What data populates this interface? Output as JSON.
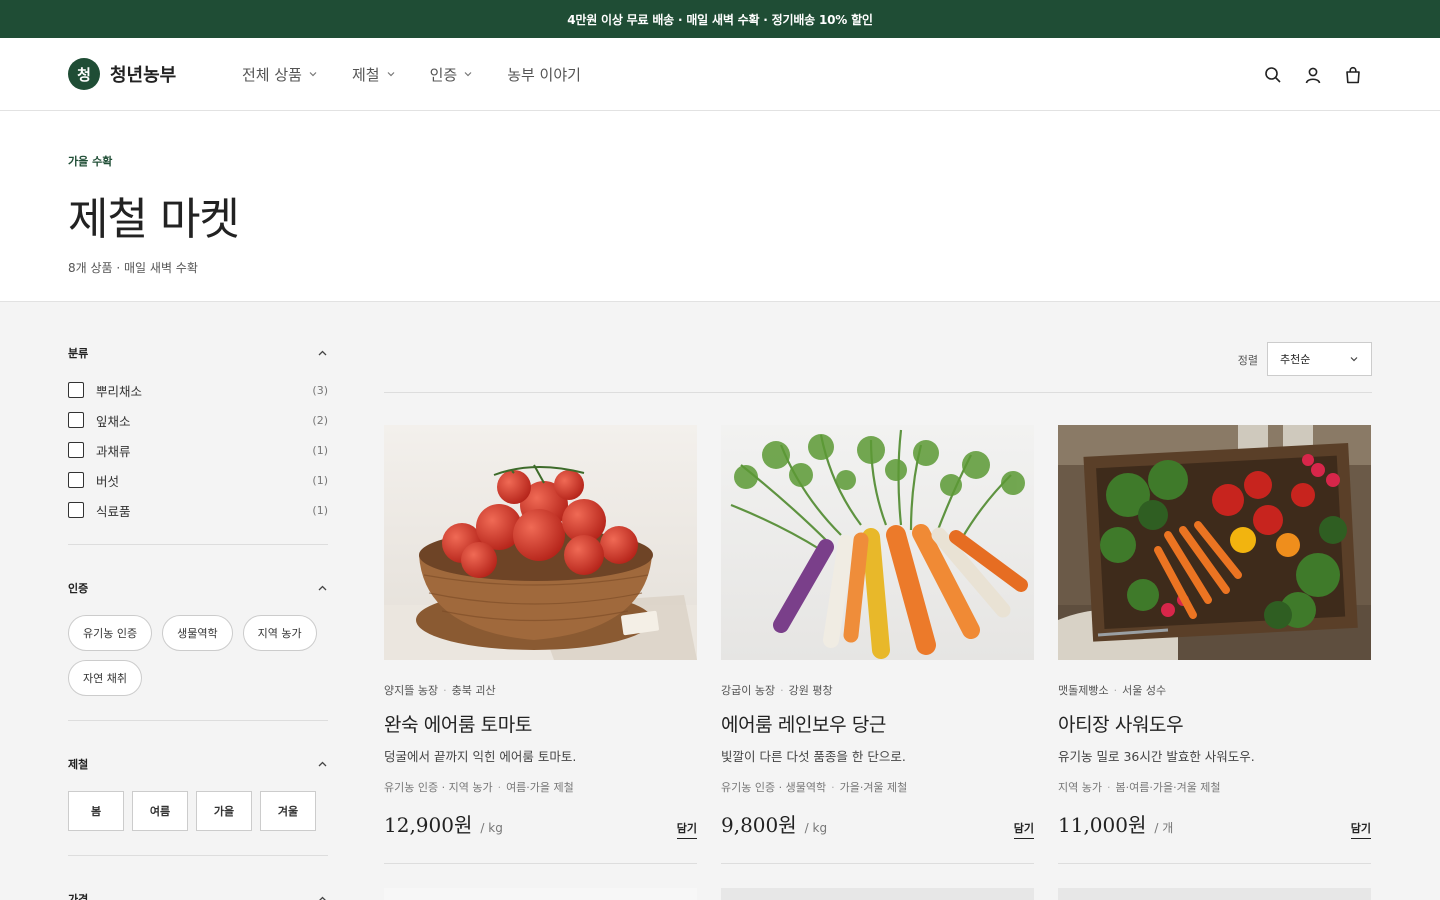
{
  "promo": "4만원 이상 무료 배송 · 매일 새벽 수확 · 정기배송 10% 할인",
  "brand": {
    "mark": "청",
    "name": "청년농부",
    "color": "#1f4d35"
  },
  "nav": [
    {
      "label": "전체 상품",
      "dropdown": true
    },
    {
      "label": "제철",
      "dropdown": true
    },
    {
      "label": "인증",
      "dropdown": true
    },
    {
      "label": "농부 이야기",
      "dropdown": false
    }
  ],
  "header_icons": [
    "search-icon",
    "user-icon",
    "bag-icon"
  ],
  "hero": {
    "eyebrow": "가을 수확",
    "title": "제철 마켓",
    "subtitle": "8개 상품 · 매일 새벽 수확"
  },
  "filters": {
    "category": {
      "title": "분류",
      "items": [
        {
          "label": "뿌리채소",
          "count": "(3)"
        },
        {
          "label": "잎채소",
          "count": "(2)"
        },
        {
          "label": "과채류",
          "count": "(1)"
        },
        {
          "label": "버섯",
          "count": "(1)"
        },
        {
          "label": "식료품",
          "count": "(1)"
        }
      ]
    },
    "certification": {
      "title": "인증",
      "chips": [
        "유기농 인증",
        "생물역학",
        "지역 농가",
        "자연 채취"
      ]
    },
    "season": {
      "title": "제철",
      "options": [
        "봄",
        "여름",
        "가을",
        "겨울"
      ]
    },
    "price": {
      "title": "가격"
    }
  },
  "sort": {
    "label": "정렬",
    "value": "추천순"
  },
  "products": [
    {
      "farm": "양지뜰 농장",
      "region": "충북 괴산",
      "name": "완숙 에어룸 토마토",
      "desc": "덩굴에서 끝까지 익힌 에어룸 토마토.",
      "certs": "유기농 인증 · 지역 농가",
      "season": "여름·가을 제철",
      "price": "12,900원",
      "unit": "/ kg",
      "add": "담기"
    },
    {
      "farm": "강굽이 농장",
      "region": "강원 평창",
      "name": "에어룸 레인보우 당근",
      "desc": "빛깔이 다른 다섯 품종을 한 단으로.",
      "certs": "유기농 인증 · 생물역학",
      "season": "가을·겨울 제철",
      "price": "9,800원",
      "unit": "/ kg",
      "add": "담기"
    },
    {
      "farm": "맷돌제빵소",
      "region": "서울 성수",
      "name": "아티장 사워도우",
      "desc": "유기농 밀로 36시간 발효한 사워도우.",
      "certs": "지역 농가",
      "season": "봄·여름·가을·겨울 제철",
      "price": "11,000원",
      "unit": "/ 개",
      "add": "담기"
    }
  ]
}
